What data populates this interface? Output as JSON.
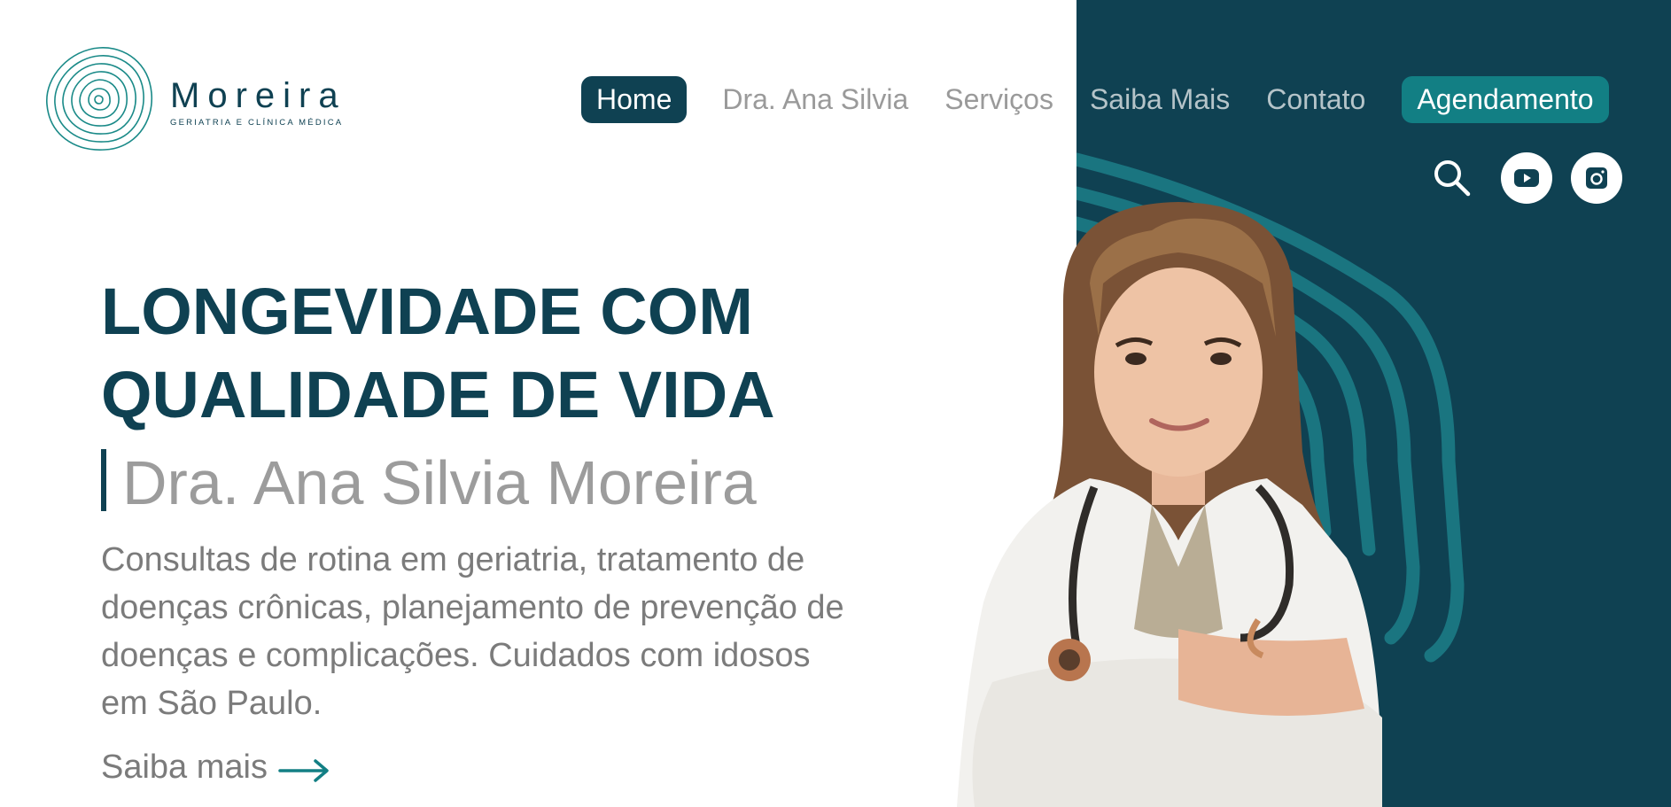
{
  "brand": {
    "name": "Moreira",
    "tagline": "GERIATRIA E CLÍNICA MÉDICA"
  },
  "nav": {
    "items": [
      {
        "label": "Home"
      },
      {
        "label": "Dra. Ana Silvia"
      },
      {
        "label": "Serviços"
      },
      {
        "label": "Saiba Mais"
      },
      {
        "label": "Contato"
      }
    ],
    "cta": "Agendamento"
  },
  "icons": {
    "search": "search-icon",
    "youtube": "youtube-icon",
    "instagram": "instagram-icon"
  },
  "hero": {
    "title_line1": "LONGEVIDADE COM",
    "title_line2": "QUALIDADE DE VIDA",
    "doctor": "Dra. Ana Silvia Moreira",
    "description": "Consultas de rotina em geriatria, tratamento de doenças crônicas, planejamento de prevenção de doenças e complicações. Cuidados com idosos em São Paulo.",
    "link": "Saiba mais"
  },
  "colors": {
    "primary": "#0f4152",
    "accent": "#127f84",
    "muted": "#9a9a9a"
  }
}
